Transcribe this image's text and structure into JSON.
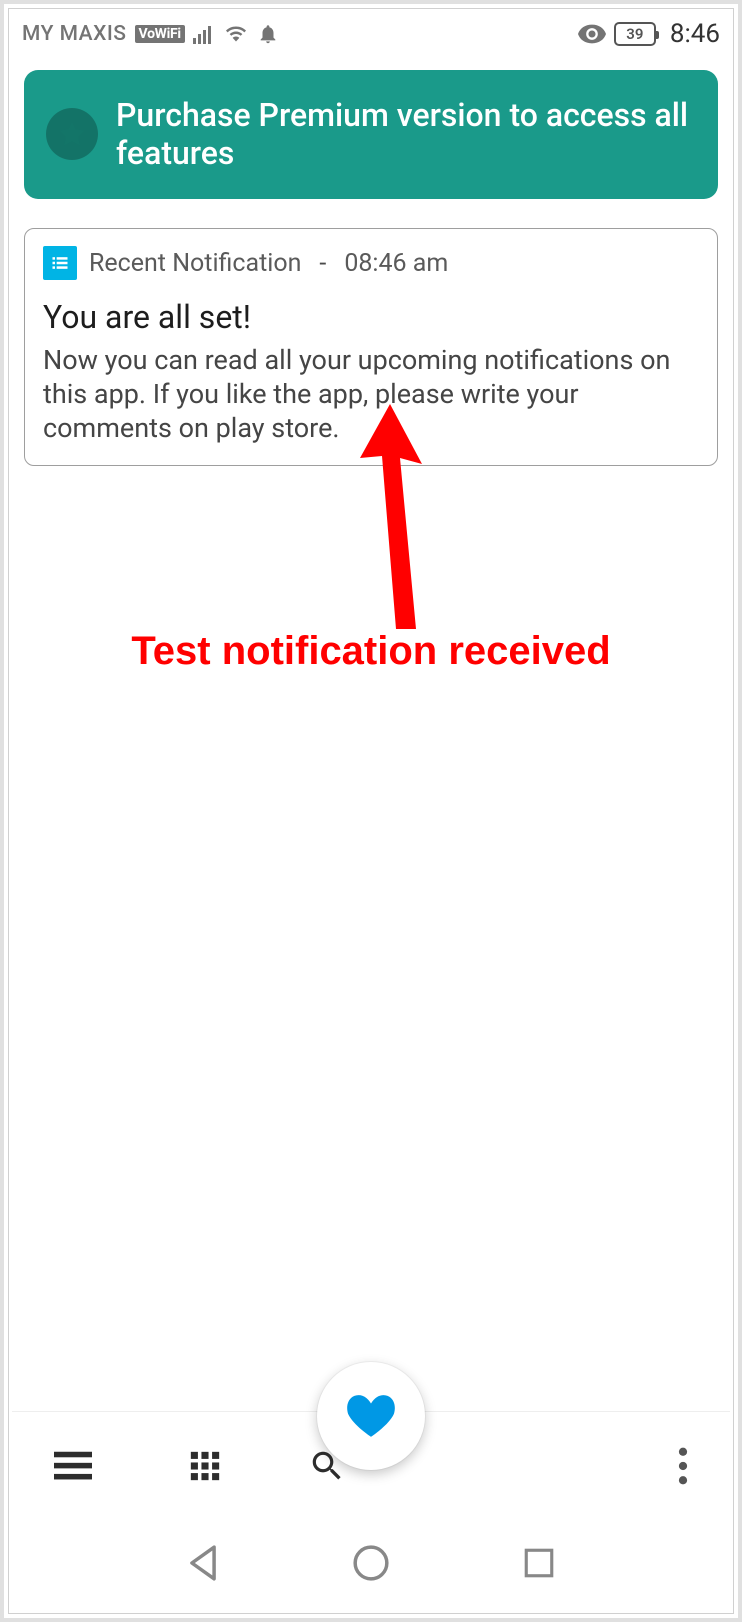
{
  "status_bar": {
    "carrier": "MY MAXIS",
    "vowifi_badge": "VoWiFi",
    "battery_pct": "39",
    "clock": "8:46"
  },
  "premium_banner": {
    "text": "Purchase Premium version to access all features"
  },
  "notification_card": {
    "app_name": "Recent Notification",
    "separator": "-",
    "time": "08:46 am",
    "title": "You are all set!",
    "body": "Now you can read all your upcoming notifications on this app. If you like the app, please write your comments on play store."
  },
  "annotation": {
    "label": "Test notification received"
  }
}
